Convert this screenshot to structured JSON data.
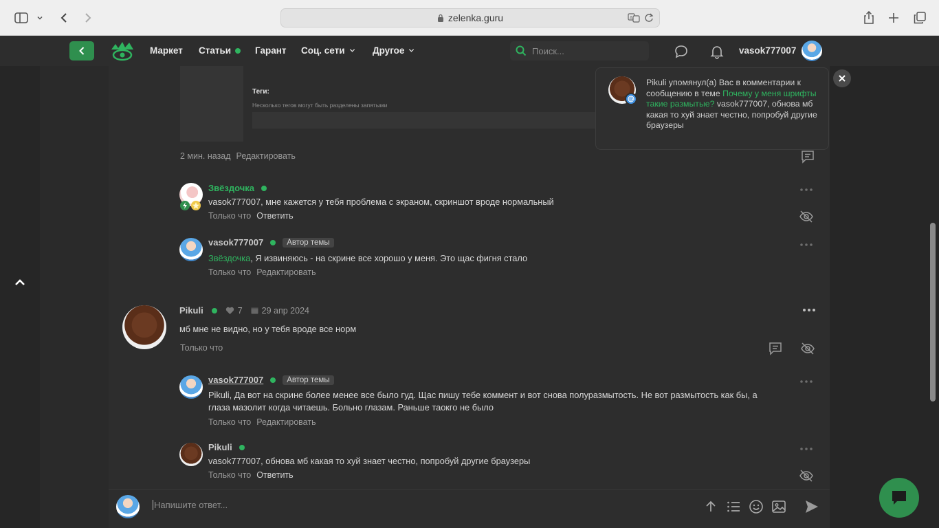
{
  "browser": {
    "url": "zelenka.guru"
  },
  "nav": {
    "items": [
      {
        "label": "Маркет"
      },
      {
        "label": "Статьи"
      },
      {
        "label": "Гарант"
      },
      {
        "label": "Соц. сети"
      },
      {
        "label": "Другое"
      }
    ],
    "search_placeholder": "Поиск...",
    "username": "vasok777007"
  },
  "editor_preview": {
    "tags_label": "Теги:",
    "tags_hint": "Несколько тегов могут быть разделены запятыми"
  },
  "post_meta": {
    "time": "2 мин. назад",
    "edit": "Редактировать"
  },
  "comments": [
    {
      "author": "Звёздочка",
      "text": "vasok777007, мне кажется у тебя проблема с экраном, скриншот вроде нормальный",
      "time": "Только что",
      "action": "Ответить"
    },
    {
      "author": "vasok777007",
      "badge": "Автор темы",
      "mention": "Звёздочка",
      "text": ", Я извиняюсь - на скрине все хорошо у меня. Это щас фигня стало",
      "time": "Только что",
      "action": "Редактировать"
    }
  ],
  "post": {
    "author": "Pikuli",
    "likes": "7",
    "date": "29 апр 2024",
    "text": "мб мне не видно, но у тебя вроде все норм",
    "time": "Только что"
  },
  "replies": [
    {
      "author": "vasok777007",
      "badge": "Автор темы",
      "text_line1": "Pikuli, Да вот на скрине более менее все было гуд. Щас пишу тебе коммент и вот снова полуразмытость. Не вот размытость как бы, а",
      "text_line2": "глаза мазолит когда читаешь. Больно глазам. Раньше таокго не было",
      "time": "Только что",
      "action": "Редактировать"
    },
    {
      "author": "Pikuli",
      "text": "vasok777007, обнова мб какая то хуй знает честно, попробуй другие браузеры",
      "time": "Только что",
      "action": "Ответить"
    }
  ],
  "notification": {
    "user": "Pikuli",
    "text1": " упомянул(а) Вас в комментарии к сообщению в теме ",
    "link": "Почему у меня шрифты такие размытые?",
    "text2": " vasok777007, обнова мб какая то хуй знает честно, попробуй другие браузеры"
  },
  "reply_box": {
    "placeholder": "Напишите ответ..."
  },
  "colors": {
    "accent": "#2fb45f",
    "button_green": "#2f8f4e",
    "background": "#262626",
    "panel": "#2d2d2d"
  }
}
